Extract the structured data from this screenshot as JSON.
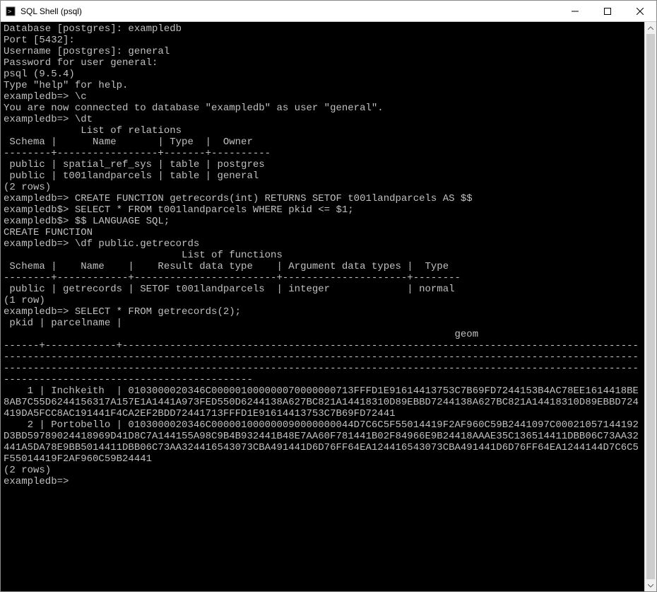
{
  "window": {
    "title": "SQL Shell (psql)"
  },
  "terminal": {
    "lines": [
      "Database [postgres]: exampledb",
      "Port [5432]:",
      "Username [postgres]: general",
      "Password for user general:",
      "psql (9.5.4)",
      "Type \"help\" for help.",
      "",
      "exampledb=> \\c",
      "You are now connected to database \"exampledb\" as user \"general\".",
      "exampledb=> \\dt",
      "             List of relations",
      " Schema |      Name       | Type  |  Owner",
      "--------+-----------------+-------+----------",
      " public | spatial_ref_sys | table | postgres",
      " public | t001landparcels | table | general",
      "(2 rows)",
      "",
      "",
      "exampledb=> CREATE FUNCTION getrecords(int) RETURNS SETOF t001landparcels AS $$",
      "exampledb$> SELECT * FROM t001landparcels WHERE pkid <= $1;",
      "exampledb$> $$ LANGUAGE SQL;",
      "CREATE FUNCTION",
      "exampledb=> \\df public.getrecords",
      "                              List of functions",
      " Schema |    Name    |    Result data type    | Argument data types |  Type",
      "--------+------------+------------------------+---------------------+--------",
      " public | getrecords | SETOF t001landparcels  | integer             | normal",
      "(1 row)",
      "",
      "",
      "exampledb=> SELECT * FROM getrecords(2);",
      " pkid | parcelname |",
      "                                                                            geom"
    ],
    "sep1": "------+------------+-------------------------------------------------------------------------------------------------------------------------------------------------------------------------------------------------------------------------------------------------------------------------------------------------------------------------------------------------------",
    "row1": "    1 | Inchkeith  | 0103000020346C000001000000070000000713FFFD1E91614413753C7B69FD7244153B4AC78EE1614418BE8AB7C55D6244156317A157E1A1441A973FED550D6244138A627BC821A14418310D89EBBD7244138A627BC821A14418310D89EBBD724419DA5FCC8AC191441F4CA2EF2BDD72441713FFFD1E91614413753C7B69FD72441",
    "row2": "    2 | Portobello | 0103000020346C000001000000090000000044D7C6C5F55014419F2AF960C59B2441097C00021057144192D3BD59789024418969D41D8C7A144155A98C9B4B932441B48E7AA60F781441B02F84966E9B24418AAAE35C136514411DBB06C73AA32441A5DA78E9BB5014411DBB06C73AA324416543073CBA491441D6D76FF64EA124416543073CBA491441D6D76FF64EA1244144D7C6C5F55014419F2AF960C59B24441",
    "after": [
      "(2 rows)",
      "",
      "",
      "exampledb=>"
    ]
  }
}
